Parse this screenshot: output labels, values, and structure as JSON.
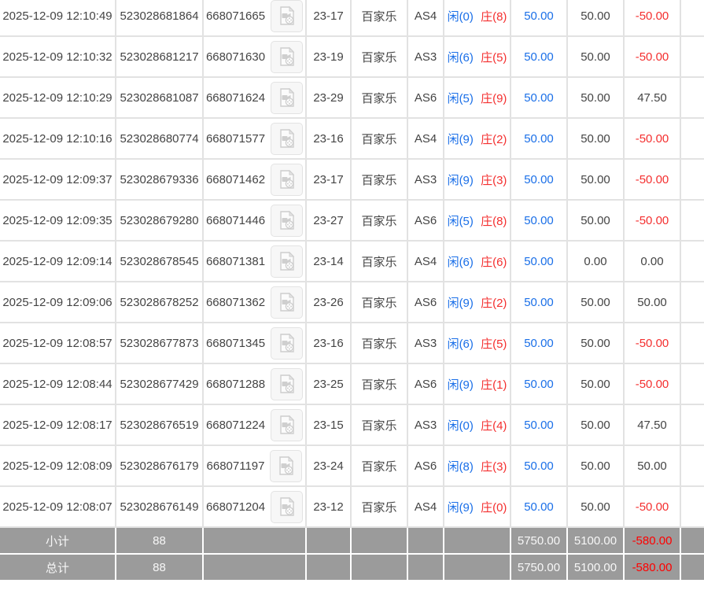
{
  "colors": {
    "accent_blue": "#1a6fe8",
    "loss_red": "#f42f2f",
    "footer_red": "#ff0000",
    "footer_bg": "#9b9b9b",
    "border_gray": "#e2e2e2"
  },
  "table": {
    "rows": [
      {
        "time": "2025-12-09 12:10:49",
        "bet_id": "523028681864",
        "video_id": "668071665",
        "round": "23-17",
        "game": "百家乐",
        "table_code": "AS4",
        "player": "闲(0)",
        "banker": "庄(8)",
        "bet": "50.00",
        "valid": "50.00",
        "winloss": "-50.00"
      },
      {
        "time": "2025-12-09 12:10:32",
        "bet_id": "523028681217",
        "video_id": "668071630",
        "round": "23-19",
        "game": "百家乐",
        "table_code": "AS3",
        "player": "闲(6)",
        "banker": "庄(5)",
        "bet": "50.00",
        "valid": "50.00",
        "winloss": "-50.00"
      },
      {
        "time": "2025-12-09 12:10:29",
        "bet_id": "523028681087",
        "video_id": "668071624",
        "round": "23-29",
        "game": "百家乐",
        "table_code": "AS6",
        "player": "闲(5)",
        "banker": "庄(9)",
        "bet": "50.00",
        "valid": "50.00",
        "winloss": "47.50"
      },
      {
        "time": "2025-12-09 12:10:16",
        "bet_id": "523028680774",
        "video_id": "668071577",
        "round": "23-16",
        "game": "百家乐",
        "table_code": "AS4",
        "player": "闲(9)",
        "banker": "庄(2)",
        "bet": "50.00",
        "valid": "50.00",
        "winloss": "-50.00"
      },
      {
        "time": "2025-12-09 12:09:37",
        "bet_id": "523028679336",
        "video_id": "668071462",
        "round": "23-17",
        "game": "百家乐",
        "table_code": "AS3",
        "player": "闲(9)",
        "banker": "庄(3)",
        "bet": "50.00",
        "valid": "50.00",
        "winloss": "-50.00"
      },
      {
        "time": "2025-12-09 12:09:35",
        "bet_id": "523028679280",
        "video_id": "668071446",
        "round": "23-27",
        "game": "百家乐",
        "table_code": "AS6",
        "player": "闲(5)",
        "banker": "庄(8)",
        "bet": "50.00",
        "valid": "50.00",
        "winloss": "-50.00"
      },
      {
        "time": "2025-12-09 12:09:14",
        "bet_id": "523028678545",
        "video_id": "668071381",
        "round": "23-14",
        "game": "百家乐",
        "table_code": "AS4",
        "player": "闲(6)",
        "banker": "庄(6)",
        "bet": "50.00",
        "valid": "0.00",
        "winloss": "0.00"
      },
      {
        "time": "2025-12-09 12:09:06",
        "bet_id": "523028678252",
        "video_id": "668071362",
        "round": "23-26",
        "game": "百家乐",
        "table_code": "AS6",
        "player": "闲(9)",
        "banker": "庄(2)",
        "bet": "50.00",
        "valid": "50.00",
        "winloss": "50.00"
      },
      {
        "time": "2025-12-09 12:08:57",
        "bet_id": "523028677873",
        "video_id": "668071345",
        "round": "23-16",
        "game": "百家乐",
        "table_code": "AS3",
        "player": "闲(6)",
        "banker": "庄(5)",
        "bet": "50.00",
        "valid": "50.00",
        "winloss": "-50.00"
      },
      {
        "time": "2025-12-09 12:08:44",
        "bet_id": "523028677429",
        "video_id": "668071288",
        "round": "23-25",
        "game": "百家乐",
        "table_code": "AS6",
        "player": "闲(9)",
        "banker": "庄(1)",
        "bet": "50.00",
        "valid": "50.00",
        "winloss": "-50.00"
      },
      {
        "time": "2025-12-09 12:08:17",
        "bet_id": "523028676519",
        "video_id": "668071224",
        "round": "23-15",
        "game": "百家乐",
        "table_code": "AS3",
        "player": "闲(0)",
        "banker": "庄(4)",
        "bet": "50.00",
        "valid": "50.00",
        "winloss": "47.50"
      },
      {
        "time": "2025-12-09 12:08:09",
        "bet_id": "523028676179",
        "video_id": "668071197",
        "round": "23-24",
        "game": "百家乐",
        "table_code": "AS6",
        "player": "闲(8)",
        "banker": "庄(3)",
        "bet": "50.00",
        "valid": "50.00",
        "winloss": "50.00"
      },
      {
        "time": "2025-12-09 12:08:07",
        "bet_id": "523028676149",
        "video_id": "668071204",
        "round": "23-12",
        "game": "百家乐",
        "table_code": "AS4",
        "player": "闲(9)",
        "banker": "庄(0)",
        "bet": "50.00",
        "valid": "50.00",
        "winloss": "-50.00"
      }
    ],
    "summary": [
      {
        "label": "小计",
        "count": "88",
        "bet": "5750.00",
        "valid": "5100.00",
        "winloss": "-580.00"
      },
      {
        "label": "总计",
        "count": "88",
        "bet": "5750.00",
        "valid": "5100.00",
        "winloss": "-580.00"
      }
    ]
  }
}
